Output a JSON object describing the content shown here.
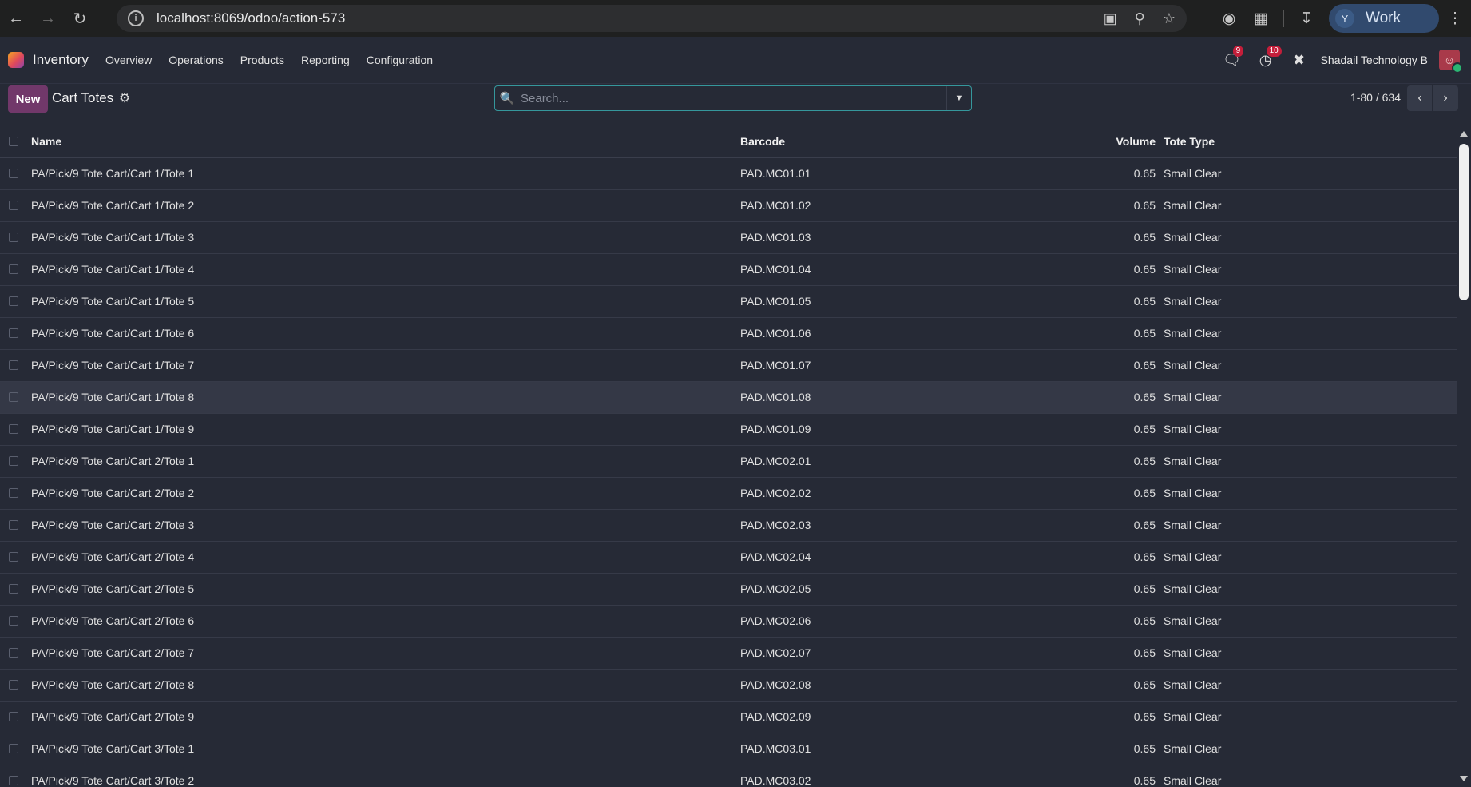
{
  "browser": {
    "url": "localhost:8069/odoo/action-573",
    "profile_initial": "Y",
    "profile_name": "Work"
  },
  "app": {
    "name": "Inventory",
    "menu": [
      "Overview",
      "Operations",
      "Products",
      "Reporting",
      "Configuration"
    ],
    "messages_count": "9",
    "activities_count": "10",
    "company": "Shadail Technology B"
  },
  "control": {
    "new_label": "New",
    "title": "Cart Totes",
    "search_placeholder": "Search...",
    "pager": "1-80 / 634"
  },
  "table": {
    "columns": {
      "name": "Name",
      "barcode": "Barcode",
      "volume": "Volume",
      "tote_type": "Tote Type"
    },
    "rows": [
      {
        "name": "PA/Pick/9 Tote Cart/Cart 1/Tote 1",
        "barcode": "PAD.MC01.01",
        "volume": "0.65",
        "tote_type": "Small Clear"
      },
      {
        "name": "PA/Pick/9 Tote Cart/Cart 1/Tote 2",
        "barcode": "PAD.MC01.02",
        "volume": "0.65",
        "tote_type": "Small Clear"
      },
      {
        "name": "PA/Pick/9 Tote Cart/Cart 1/Tote 3",
        "barcode": "PAD.MC01.03",
        "volume": "0.65",
        "tote_type": "Small Clear"
      },
      {
        "name": "PA/Pick/9 Tote Cart/Cart 1/Tote 4",
        "barcode": "PAD.MC01.04",
        "volume": "0.65",
        "tote_type": "Small Clear"
      },
      {
        "name": "PA/Pick/9 Tote Cart/Cart 1/Tote 5",
        "barcode": "PAD.MC01.05",
        "volume": "0.65",
        "tote_type": "Small Clear"
      },
      {
        "name": "PA/Pick/9 Tote Cart/Cart 1/Tote 6",
        "barcode": "PAD.MC01.06",
        "volume": "0.65",
        "tote_type": "Small Clear"
      },
      {
        "name": "PA/Pick/9 Tote Cart/Cart 1/Tote 7",
        "barcode": "PAD.MC01.07",
        "volume": "0.65",
        "tote_type": "Small Clear"
      },
      {
        "name": "PA/Pick/9 Tote Cart/Cart 1/Tote 8",
        "barcode": "PAD.MC01.08",
        "volume": "0.65",
        "tote_type": "Small Clear"
      },
      {
        "name": "PA/Pick/9 Tote Cart/Cart 1/Tote 9",
        "barcode": "PAD.MC01.09",
        "volume": "0.65",
        "tote_type": "Small Clear"
      },
      {
        "name": "PA/Pick/9 Tote Cart/Cart 2/Tote 1",
        "barcode": "PAD.MC02.01",
        "volume": "0.65",
        "tote_type": "Small Clear"
      },
      {
        "name": "PA/Pick/9 Tote Cart/Cart 2/Tote 2",
        "barcode": "PAD.MC02.02",
        "volume": "0.65",
        "tote_type": "Small Clear"
      },
      {
        "name": "PA/Pick/9 Tote Cart/Cart 2/Tote 3",
        "barcode": "PAD.MC02.03",
        "volume": "0.65",
        "tote_type": "Small Clear"
      },
      {
        "name": "PA/Pick/9 Tote Cart/Cart 2/Tote 4",
        "barcode": "PAD.MC02.04",
        "volume": "0.65",
        "tote_type": "Small Clear"
      },
      {
        "name": "PA/Pick/9 Tote Cart/Cart 2/Tote 5",
        "barcode": "PAD.MC02.05",
        "volume": "0.65",
        "tote_type": "Small Clear"
      },
      {
        "name": "PA/Pick/9 Tote Cart/Cart 2/Tote 6",
        "barcode": "PAD.MC02.06",
        "volume": "0.65",
        "tote_type": "Small Clear"
      },
      {
        "name": "PA/Pick/9 Tote Cart/Cart 2/Tote 7",
        "barcode": "PAD.MC02.07",
        "volume": "0.65",
        "tote_type": "Small Clear"
      },
      {
        "name": "PA/Pick/9 Tote Cart/Cart 2/Tote 8",
        "barcode": "PAD.MC02.08",
        "volume": "0.65",
        "tote_type": "Small Clear"
      },
      {
        "name": "PA/Pick/9 Tote Cart/Cart 2/Tote 9",
        "barcode": "PAD.MC02.09",
        "volume": "0.65",
        "tote_type": "Small Clear"
      },
      {
        "name": "PA/Pick/9 Tote Cart/Cart 3/Tote 1",
        "barcode": "PAD.MC03.01",
        "volume": "0.65",
        "tote_type": "Small Clear"
      },
      {
        "name": "PA/Pick/9 Tote Cart/Cart 3/Tote 2",
        "barcode": "PAD.MC03.02",
        "volume": "0.65",
        "tote_type": "Small Clear"
      }
    ]
  }
}
